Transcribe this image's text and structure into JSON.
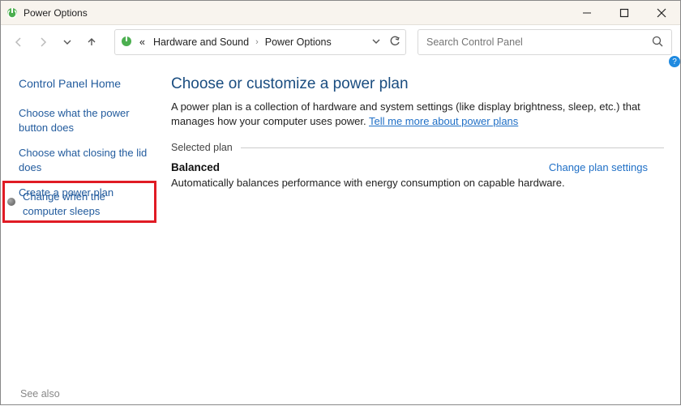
{
  "window": {
    "title": "Power Options"
  },
  "breadcrumb": {
    "prefix": "«",
    "items": [
      "Hardware and Sound",
      "Power Options"
    ]
  },
  "search": {
    "placeholder": "Search Control Panel"
  },
  "sidebar": {
    "home": "Control Panel Home",
    "links": [
      "Choose what the power button does",
      "Choose what closing the lid does",
      "Create a power plan",
      "Change when the computer sleeps"
    ],
    "see_also": "See also"
  },
  "main": {
    "heading": "Choose or customize a power plan",
    "description_pre": "A power plan is a collection of hardware and system settings (like display brightness, sleep, etc.) that manages how your computer uses power. ",
    "description_link": "Tell me more about power plans",
    "section_label": "Selected plan",
    "plan": {
      "name": "Balanced",
      "change_link": "Change plan settings",
      "description": "Automatically balances performance with energy consumption on capable hardware."
    }
  }
}
